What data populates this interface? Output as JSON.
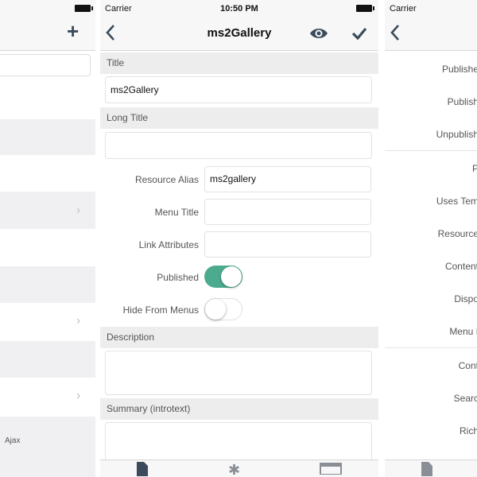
{
  "left_screen": {
    "footer_text": "Ajax"
  },
  "center_screen": {
    "status": {
      "carrier": "Carrier",
      "time": "10:50 PM"
    },
    "nav": {
      "title": "ms2Gallery"
    },
    "sections": {
      "title_header": "Title",
      "title_value": "ms2Gallery",
      "long_title_header": "Long Title",
      "long_title_value": "",
      "description_header": "Description",
      "summary_header": "Summary (introtext)"
    },
    "rows": {
      "resource_alias_label": "Resource Alias",
      "resource_alias_value": "ms2gallery",
      "menu_title_label": "Menu Title",
      "menu_title_value": "",
      "link_attributes_label": "Link Attributes",
      "link_attributes_value": "",
      "published_label": "Published",
      "published_on": true,
      "hide_from_menus_label": "Hide From Menus",
      "hide_from_menus_on": false
    }
  },
  "right_screen": {
    "status": {
      "carrier": "Carrier"
    },
    "items": [
      "Publishe",
      "Publish",
      "Unpublish",
      "P",
      "Uses Tem",
      "Resource",
      "Content",
      "Dispo",
      "Menu I",
      "Cont",
      "Searc",
      "Rich"
    ]
  },
  "colors": {
    "accent": "#4cab8f",
    "nav_icon": "#3b4b5b",
    "section_bg": "#ededee"
  }
}
